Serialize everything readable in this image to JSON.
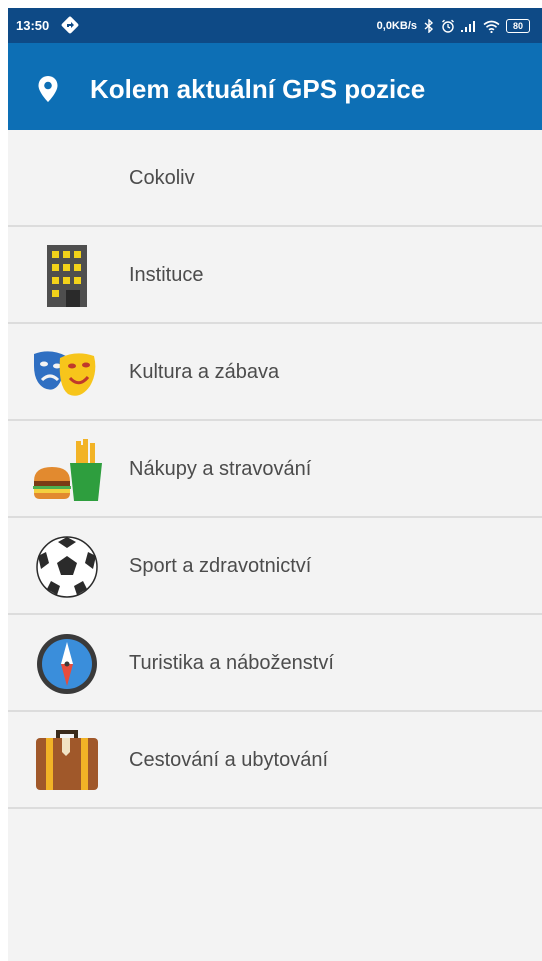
{
  "status_bar": {
    "time": "13:50",
    "net_speed": "0,0KB/s",
    "battery": "80",
    "icons": [
      "navigation-icon",
      "bluetooth-icon",
      "alarm-icon",
      "signal-icon",
      "wifi-icon",
      "battery-icon"
    ]
  },
  "header": {
    "title": "Kolem aktuální GPS pozice",
    "icon": "location-pin-icon",
    "color": "#0d6fb5"
  },
  "categories": [
    {
      "label": "Cokoliv",
      "icon": ""
    },
    {
      "label": "Instituce",
      "icon": "building-icon"
    },
    {
      "label": "Kultura a zábava",
      "icon": "theater-masks-icon"
    },
    {
      "label": "Nákupy a stravování",
      "icon": "fast-food-icon"
    },
    {
      "label": "Sport a zdravotnictví",
      "icon": "soccer-ball-icon"
    },
    {
      "label": "Turistika a náboženství",
      "icon": "compass-icon"
    },
    {
      "label": "Cestování a ubytování",
      "icon": "suitcase-icon"
    }
  ]
}
